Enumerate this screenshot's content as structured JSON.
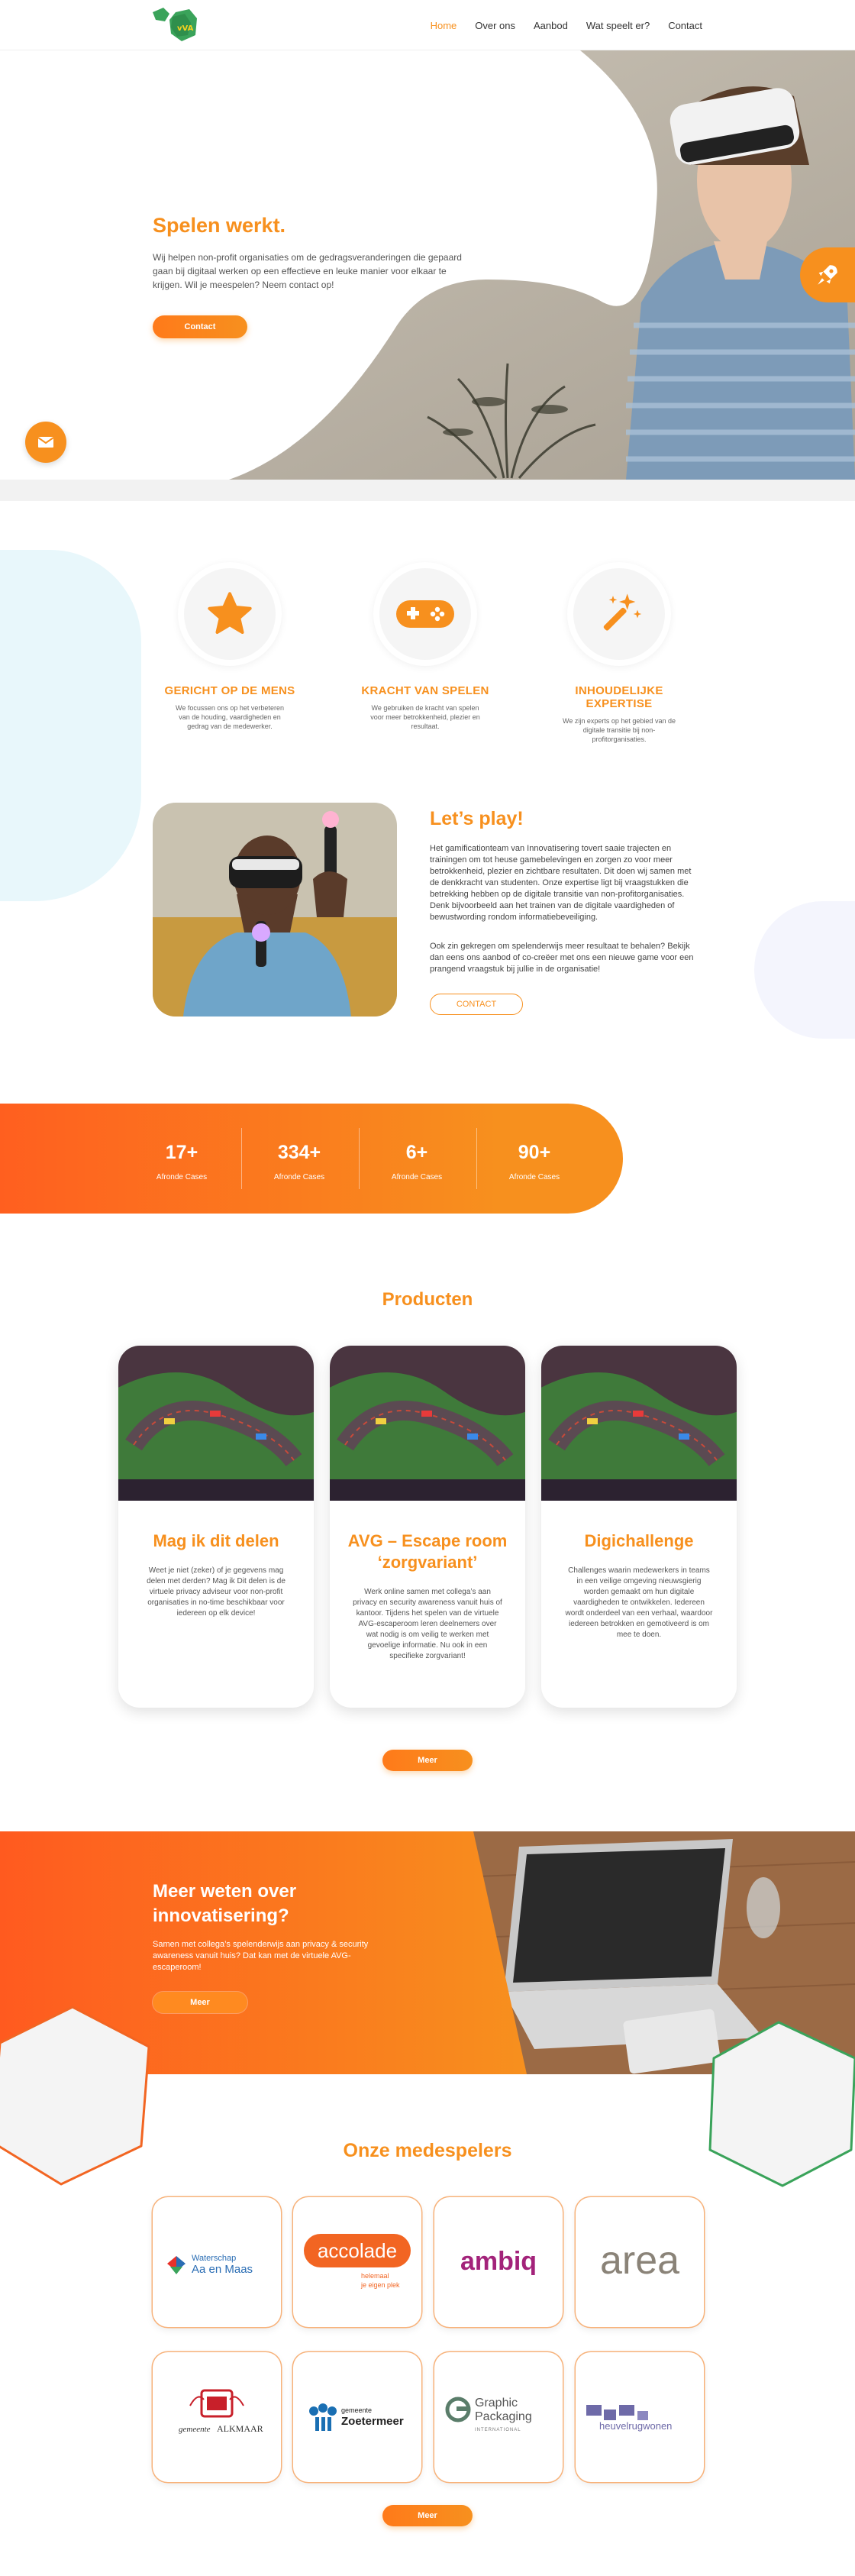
{
  "brand": {
    "logo_text": "vVA",
    "accent": "#f7901e",
    "accent_dark": "#ff5f1f",
    "green": "#3aa35a"
  },
  "nav": {
    "items": [
      {
        "label": "Home",
        "active": true
      },
      {
        "label": "Over ons",
        "active": false
      },
      {
        "label": "Aanbod",
        "active": false
      },
      {
        "label": "Wat speelt er?",
        "active": false
      },
      {
        "label": "Contact",
        "active": false
      }
    ]
  },
  "hero": {
    "title": "Spelen werkt.",
    "text": "Wij helpen non-profit organisaties om de gedragsveranderingen die gepaard gaan bij digitaal werken op een effectieve en leuke manier voor elkaar te krijgen. Wil je meespelen? Neem contact op!",
    "button": "Contact"
  },
  "features": [
    {
      "icon": "star-icon",
      "title": "GERICHT OP DE MENS",
      "text": "We focussen ons op het verbeteren van de houding, vaardigheden en gedrag van de medewerker."
    },
    {
      "icon": "gamepad-icon",
      "title": "KRACHT VAN SPELEN",
      "text": "We gebruiken de kracht van spelen voor meer betrokkenheid, plezier en resultaat."
    },
    {
      "icon": "magic-wand-icon",
      "title": "INHOUDELIJKE EXPERTISE",
      "text": "We zijn experts op het gebied van de digitale transitie bij non-profitorganisaties."
    }
  ],
  "play": {
    "title": "Let’s play!",
    "text1": "Het gamificationteam van Innovatisering tovert saaie trajecten en trainingen om tot heuse gamebelevingen en zorgen zo voor meer betrokkenheid, plezier en zichtbare resultaten. Dit doen wij samen met de denkkracht van studenten. Onze expertise ligt bij vraagstukken die betrekking hebben op de digitale transitie van non-profitorganisaties. Denk bijvoorbeeld aan het trainen van de digitale vaardigheden of bewustwording rondom informatiebeveiliging.",
    "text2": "Ook zin gekregen om spelenderwijs meer resultaat te behalen? Bekijk dan eens ons aanbod of co-creëer met ons een nieuwe game voor een prangend vraagstuk bij jullie in de organisatie!",
    "button": "CONTACT"
  },
  "stats": [
    {
      "value": "17+",
      "label": "Afronde Cases"
    },
    {
      "value": "334+",
      "label": "Afronde Cases"
    },
    {
      "value": "6+",
      "label": "Afronde Cases"
    },
    {
      "value": "90+",
      "label": "Afronde Cases"
    }
  ],
  "products": {
    "title": "Producten",
    "items": [
      {
        "title": "Mag ik dit delen",
        "text": "Weet je niet (zeker) of je gegevens mag delen met derden? Mag ik Dit delen is de virtuele privacy adviseur voor non-profit organisaties in no-time beschikbaar voor iedereen op elk device!"
      },
      {
        "title": "AVG – Escape room ‘zorgvariant’",
        "text": "Werk online samen met collega’s aan privacy en security awareness vanuit huis of kantoor. Tijdens het spelen van de virtuele AVG-escaperoom leren deelnemers over wat nodig is om veilig te werken met gevoelige informatie. Nu ook in een specifieke zorgvariant!"
      },
      {
        "title": "Digichallenge",
        "text": "Challenges waarin medewerkers in teams in een veilige omgeving nieuwsgierig worden gemaakt om hun digitale vaardigheden te ontwikkelen. Iedereen wordt onderdeel van een verhaal, waardoor iedereen betrokken en gemotiveerd is om mee te doen."
      }
    ],
    "button": "Meer"
  },
  "cta": {
    "title": "Meer weten over innovatisering?",
    "text": "Samen met collega’s spelenderwijs aan privacy & security awareness vanuit huis? Dat kan met de virtuele AVG-escaperoom!",
    "button": "Meer"
  },
  "partners": {
    "title": "Onze medespelers",
    "logos": [
      {
        "name": "waterschap-aa-en-maas",
        "line1": "Waterschap",
        "line2": "Aa en Maas"
      },
      {
        "name": "accolade",
        "line1": "accolade",
        "line2": "helemaal",
        "line3": "je eigen plek"
      },
      {
        "name": "ambiq",
        "line1": "ambiq"
      },
      {
        "name": "area",
        "line1": "area"
      },
      {
        "name": "gemeente-alkmaar",
        "line1": "gemeente",
        "line2": "ALKMAAR"
      },
      {
        "name": "gemeente-zoetermeer",
        "line1": "gemeente",
        "line2": "Zoetermeer"
      },
      {
        "name": "graphic-packaging",
        "line1": "Graphic",
        "line2": "Packaging",
        "line3": "INTERNATIONAL"
      },
      {
        "name": "heuvelrug-wonen",
        "line1": "heuvelrugwonen"
      }
    ],
    "button": "Meer"
  }
}
